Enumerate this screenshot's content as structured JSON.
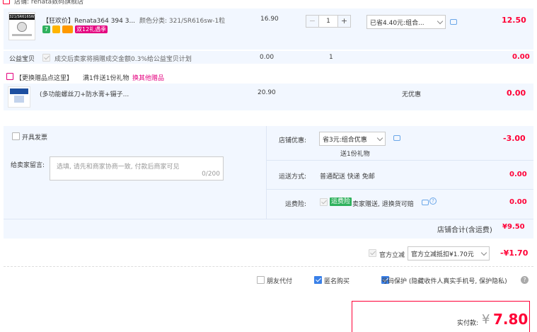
{
  "store": {
    "label": "店铺: renata数码旗舰店"
  },
  "item1": {
    "thumb_text": "321/SR616SW",
    "title": "【狂欢价】Renata364 394 3...",
    "spec": "颜色分类: 321/SR616sw-1粒",
    "price": "16.90",
    "qty": "1",
    "promo_select": "已省4.40元:组合...",
    "total": "12.50",
    "badge_text": "双12礼遇季",
    "badge_color": "#e4007f",
    "tag_color_1": "#2fb15d",
    "tag_color_2": "#ffb400",
    "tag_color_3": "#ff9900"
  },
  "charity": {
    "label": "公益宝贝",
    "desc": "成交后卖家将捐赠成交金额0.3%给公益宝贝计划",
    "price": "0.00",
    "qty": "1",
    "total": "0.00"
  },
  "gift_banner": {
    "title": "【更换赠品点这里】",
    "note": "满1件送1份礼物",
    "link": "换其他赠品"
  },
  "gift_item": {
    "title": "(多功能螺丝刀+防水膏+镊子...",
    "price": "20.90",
    "discount": "无优惠",
    "total": "0.00"
  },
  "invoice": {
    "label": "开具发票"
  },
  "message": {
    "label": "给卖家留言:",
    "placeholder": "选填, 请先和商家协商一致, 付款后商家可见",
    "count": "0/200"
  },
  "shop_discount": {
    "label": "店铺优惠:",
    "select": "省3元:组合优惠",
    "sub": "送1份礼物",
    "value": "-3.00"
  },
  "delivery": {
    "label": "运送方式:",
    "text": "普通配送 快递 免邮",
    "value": "0.00"
  },
  "insurance": {
    "label": "运费险:",
    "tag": "运费险",
    "text": "卖家赠送, 退换货可赔",
    "value": "0.00"
  },
  "shop_total": {
    "label": "店铺合计(含运费)",
    "value": "¥9.50"
  },
  "direct": {
    "label": "官方立减",
    "select": "官方立减抵扣¥1.70元",
    "value": "-¥1.70"
  },
  "options": {
    "friend_pay": "朋友代付",
    "anonymous": "匿名购买",
    "number_protect": "号码保护 (隐藏收件人真实手机号, 保护隐私)"
  },
  "payment": {
    "label": "实付款:",
    "currency": "¥",
    "amount": "7.80"
  }
}
